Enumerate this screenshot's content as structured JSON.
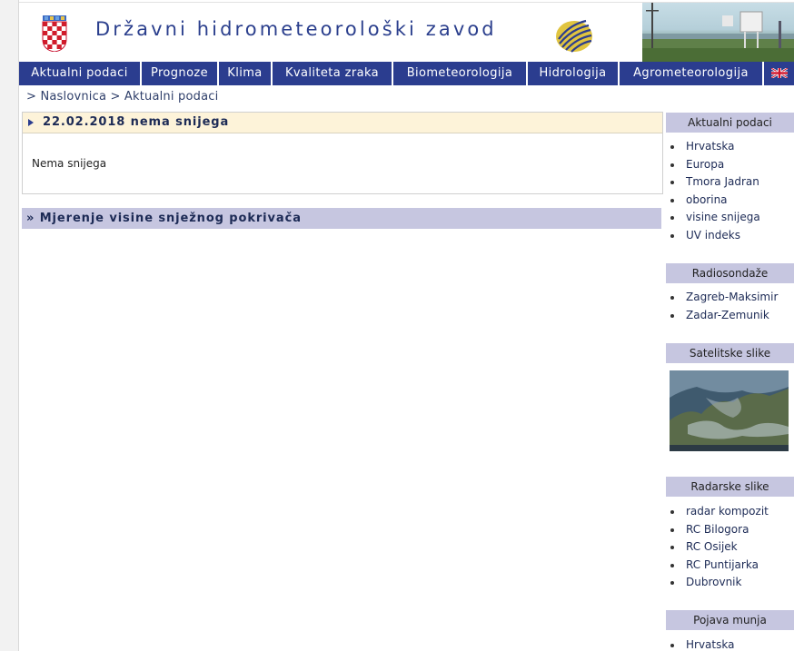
{
  "header": {
    "title": "Državni hidrometeorološki zavod"
  },
  "nav": {
    "items": [
      {
        "label": "Aktualni podaci",
        "width": 135
      },
      {
        "label": "Prognoze",
        "width": 85
      },
      {
        "label": "Klima",
        "width": 59
      },
      {
        "label": "Kvaliteta zraka",
        "width": 133
      },
      {
        "label": "Biometeorologija",
        "width": 148
      },
      {
        "label": "Hidrologija",
        "width": 101
      },
      {
        "label": "Agrometeorologija",
        "width": 159
      }
    ]
  },
  "breadcrumb": {
    "items": [
      "Naslovnica",
      "Aktualni podaci"
    ]
  },
  "article": {
    "title": "22.02.2018 nema snijega",
    "body": "Nema snijega"
  },
  "subsection": {
    "title": "» Mjerenje visine snježnog pokrivača"
  },
  "sidebar": {
    "sections": [
      {
        "title": "Aktualni podaci",
        "items": [
          "Hrvatska",
          "Europa",
          "Tmora Jadran",
          "oborina",
          "visine snijega",
          "UV indeks"
        ]
      },
      {
        "title": "Radiosondaže",
        "items": [
          "Zagreb-Maksimir",
          "Zadar-Zemunik"
        ]
      },
      {
        "title": "Satelitske slike",
        "items": []
      },
      {
        "title": "Radarske slike",
        "items": [
          "radar kompozit",
          "RC Bilogora",
          "RC Osijek",
          "RC Puntijarka",
          "Dubrovnik"
        ]
      },
      {
        "title": "Pojava munja",
        "items": [
          "Hrvatska"
        ]
      }
    ]
  },
  "colors": {
    "nav_bg": "#2b3d8f",
    "sidebar_head_bg": "#c6c6e0",
    "article_head_bg": "#fdf3d9",
    "title_blue": "#2b3f8d"
  }
}
